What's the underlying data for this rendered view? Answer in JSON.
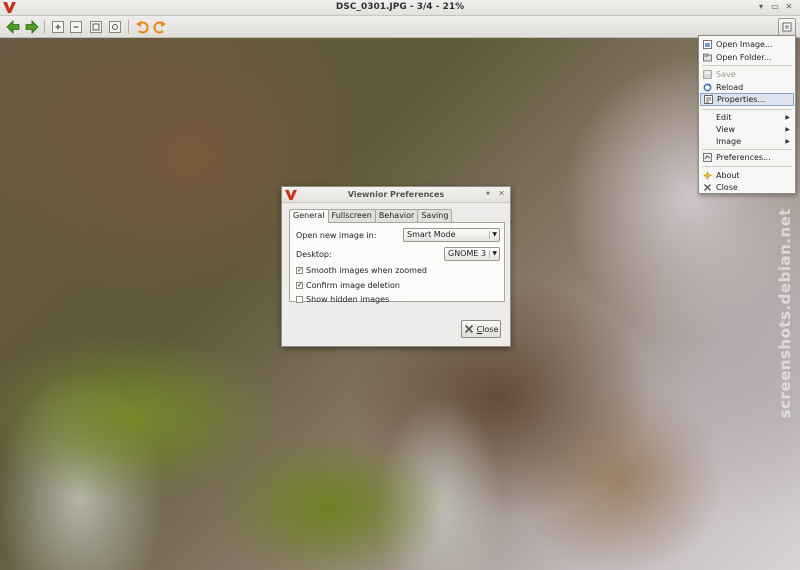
{
  "window": {
    "title": "DSC_0301.JPG - 3/4 - 21%",
    "controls": [
      "▾",
      "▭",
      "✕"
    ]
  },
  "toolbar": {
    "icons": [
      "go-back-icon",
      "go-forward-icon",
      "zoom-in-icon",
      "zoom-out-icon",
      "zoom-fit-icon",
      "zoom-100-icon",
      "rotate-left-icon",
      "rotate-right-icon"
    ],
    "menu_icon": "menu-icon"
  },
  "dialog": {
    "title": "Viewnior Preferences",
    "tabs": [
      {
        "label": "General",
        "active": true
      },
      {
        "label": "Fullscreen",
        "active": false
      },
      {
        "label": "Behavior",
        "active": false
      },
      {
        "label": "Saving",
        "active": false
      }
    ],
    "open_new_label": "Open new image in:",
    "open_new_value": "Smart Mode",
    "desktop_label": "Desktop:",
    "desktop_value": "GNOME 3",
    "checkboxes": [
      {
        "label": "Smooth images when zoomed",
        "checked": true
      },
      {
        "label": "Confirm image deletion",
        "checked": true
      },
      {
        "label": "Show hidden images",
        "checked": false
      }
    ],
    "close_label": "Close",
    "close_mnemonic": "C"
  },
  "menu": {
    "items": [
      {
        "label": "Open Image...",
        "icon": "open-image-icon",
        "disabled": false
      },
      {
        "label": "Open Folder...",
        "icon": "open-folder-icon",
        "disabled": false
      },
      {
        "label": "Save",
        "icon": "save-icon",
        "disabled": true
      },
      {
        "label": "Reload",
        "icon": "reload-icon",
        "disabled": false
      },
      {
        "label": "Properties...",
        "icon": "properties-icon",
        "disabled": false,
        "selected": true
      },
      {
        "label": "Edit",
        "submenu": true
      },
      {
        "label": "View",
        "submenu": true
      },
      {
        "label": "Image",
        "submenu": true
      },
      {
        "label": "Preferences...",
        "icon": "preferences-icon",
        "disabled": false
      },
      {
        "label": "About",
        "icon": "about-icon",
        "disabled": false
      },
      {
        "label": "Close",
        "icon": "close-icon",
        "disabled": false
      }
    ]
  },
  "watermark": "screenshots.debian.net",
  "colors": {
    "accent_red": "#c8321e",
    "arrow_green": "#4e9a2a",
    "rotate_orange": "#e8861b",
    "menu_selection": "#dde4ef"
  }
}
